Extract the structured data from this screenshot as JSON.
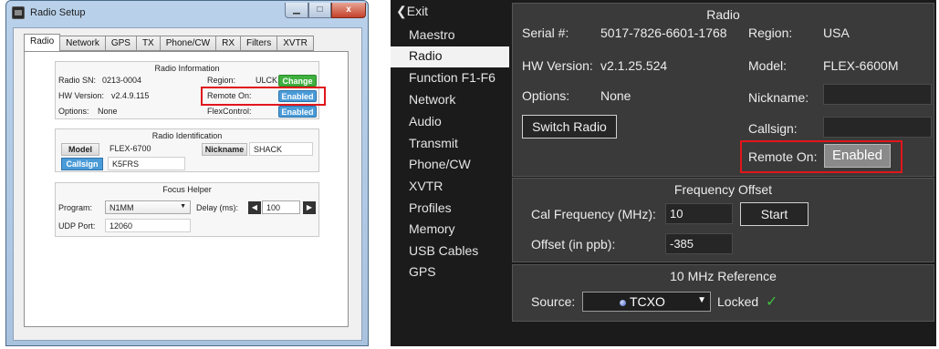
{
  "left_dialog": {
    "title": "Radio Setup",
    "window_buttons": {
      "minimize": "▁",
      "maximize": "□",
      "close": "x"
    },
    "tabs": [
      "Radio",
      "Network",
      "GPS",
      "TX",
      "Phone/CW",
      "RX",
      "Filters",
      "XVTR"
    ],
    "radio_information": {
      "heading": "Radio Information",
      "radio_sn_label": "Radio SN:",
      "radio_sn_value": "0213-0004",
      "region_label": "Region:",
      "region_value": "ULCK",
      "change_label": "Change",
      "hw_version_label": "HW Version:",
      "hw_version_value": "v2.4.9.115",
      "remote_on_label": "Remote On:",
      "remote_on_value": "Enabled",
      "options_label": "Options:",
      "options_value": "None",
      "flexcontrol_label": "FlexControl:",
      "flexcontrol_value": "Enabled"
    },
    "radio_identification": {
      "heading": "Radio Identification",
      "model_label": "Model",
      "model_value": "FLEX-6700",
      "nickname_label": "Nickname",
      "nickname_value": "SHACK",
      "callsign_label": "Callsign",
      "callsign_value": "K5FRS"
    },
    "focus_helper": {
      "heading": "Focus Helper",
      "program_label": "Program:",
      "program_value": "N1MM",
      "delay_label": "Delay (ms):",
      "delay_value": "100",
      "udp_port_label": "UDP Port:",
      "udp_port_value": "12060"
    }
  },
  "right_panel": {
    "back_label": "Exit",
    "nav_items": [
      "Maestro",
      "Radio",
      "Function F1-F6",
      "Network",
      "Audio",
      "Transmit",
      "Phone/CW",
      "XVTR",
      "Profiles",
      "Memory",
      "USB Cables",
      "GPS"
    ],
    "active_nav": "Radio",
    "radio": {
      "heading": "Radio",
      "serial_label": "Serial #:",
      "serial_value": "5017-7826-6601-1768",
      "region_label": "Region:",
      "region_value": "USA",
      "hw_version_label": "HW Version:",
      "hw_version_value": "v2.1.25.524",
      "model_label": "Model:",
      "model_value": "FLEX-6600M",
      "options_label": "Options:",
      "options_value": "None",
      "nickname_label": "Nickname:",
      "nickname_value": "",
      "switch_radio_label": "Switch Radio",
      "callsign_label": "Callsign:",
      "callsign_value": "",
      "remote_on_label": "Remote On:",
      "remote_on_value": "Enabled"
    },
    "frequency_offset": {
      "heading": "Frequency Offset",
      "cal_frequency_label": "Cal Frequency (MHz):",
      "cal_frequency_value": "10",
      "start_label": "Start",
      "offset_label": "Offset (in ppb):",
      "offset_value": "-385"
    },
    "reference": {
      "heading": "10 MHz Reference",
      "source_label": "Source:",
      "source_value": "TCXO",
      "locked_label": "Locked",
      "locked_mark": "✓"
    }
  }
}
